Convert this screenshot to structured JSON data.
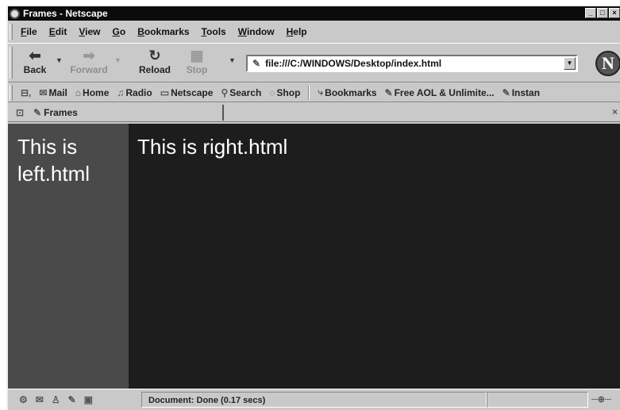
{
  "window": {
    "title": "Frames - Netscape"
  },
  "menu": [
    "File",
    "Edit",
    "View",
    "Go",
    "Bookmarks",
    "Tools",
    "Window",
    "Help"
  ],
  "nav": {
    "back": "Back",
    "forward": "Forward",
    "reload": "Reload",
    "stop": "Stop",
    "url": "file:///C:/WINDOWS/Desktop/index.html",
    "logo": "N"
  },
  "personal": [
    "Mail",
    "Home",
    "Radio",
    "Netscape",
    "Search",
    "Shop",
    "Bookmarks",
    "Free AOL & Unlimite...",
    "Instan"
  ],
  "tab": {
    "label": "Frames",
    "close": "×"
  },
  "frames": {
    "left_text": "This is left.html",
    "right_text": "This is right.html"
  },
  "status": {
    "text": "Document: Done (0.17 secs)"
  },
  "colors": {
    "left_frame": "#4a4a4a",
    "right_frame": "#1d1d1d"
  }
}
